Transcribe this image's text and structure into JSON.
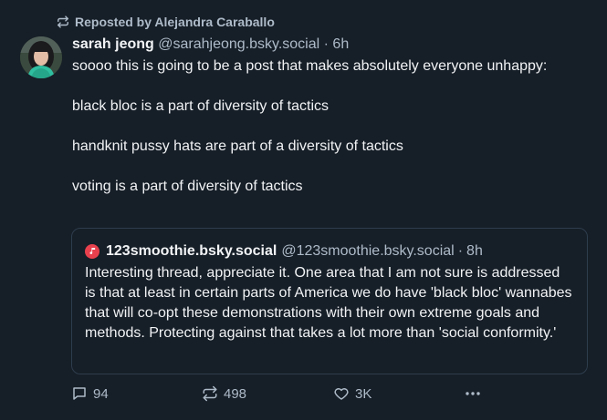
{
  "repost": {
    "label": "Reposted by Alejandra Caraballo"
  },
  "post": {
    "author_name": "sarah jeong",
    "author_handle": "@sarahjeong.bsky.social",
    "separator": "·",
    "time": "6h",
    "paragraphs": [
      "soooo this is going to be a post that makes absolutely everyone unhappy:",
      "black bloc is a part of diversity of tactics",
      "handknit pussy hats are part of a diversity of tactics",
      "voting is a part of diversity of tactics"
    ]
  },
  "quote": {
    "author_name": "123smoothie.bsky.social",
    "author_handle": "@123smoothie.bsky.social",
    "separator": "·",
    "time": "8h",
    "text": "Interesting thread, appreciate it. One area that I am not sure is addressed is that at least in certain parts of America we do have 'black bloc' wannabes that will co-opt these demonstrations with their own extreme goals and methods. Protecting against that takes a lot more than 'social conformity.'",
    "avatar_color": "#e8414d"
  },
  "actions": {
    "replies": "94",
    "reposts": "498",
    "likes": "3K",
    "more_icon": "ellipsis-icon"
  },
  "colors": {
    "background": "#161e27",
    "text": "#f1f3f5",
    "muted": "#aebbc9",
    "border": "#2e3d4d"
  }
}
